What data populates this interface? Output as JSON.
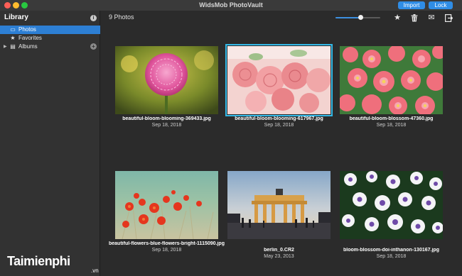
{
  "app": {
    "title": "WidsMob PhotoVault"
  },
  "titlebar": {
    "import_label": "Import",
    "lock_label": "Lock"
  },
  "sidebar": {
    "header": "Library",
    "info_glyph": "i",
    "items": [
      {
        "label": "Photos",
        "icon": "photos-icon",
        "glyph": "▭",
        "active": true
      },
      {
        "label": "Favorites",
        "icon": "star-icon",
        "glyph": "★",
        "active": false
      },
      {
        "label": "Albums",
        "icon": "albums-icon",
        "glyph": "▤",
        "active": false,
        "arrow": "▶",
        "add": "+"
      }
    ]
  },
  "toolbar": {
    "count_label": "9 Photos",
    "zoom_level": 0.55,
    "tools": [
      {
        "name": "favorite-star-icon",
        "glyph": "★"
      },
      {
        "name": "trash-icon",
        "glyph": "🗑"
      },
      {
        "name": "mail-icon",
        "glyph": "✉"
      },
      {
        "name": "export-icon",
        "glyph": "⇥"
      }
    ]
  },
  "photos": [
    {
      "name": "beautiful-bloom-blooming-369433.jpg",
      "date": "Sep 18, 2018",
      "selected": false
    },
    {
      "name": "beautiful-bloom-blooming-617967.jpg",
      "date": "Sep 18, 2018",
      "selected": true
    },
    {
      "name": "beautiful-bloom-blossom-47360.jpg",
      "date": "Sep 18, 2018",
      "selected": false
    },
    {
      "name": "beautiful-flowers-blue-flowers-bright-1115090.jpg",
      "date": "Sep 18, 2018",
      "selected": false
    },
    {
      "name": "berlin_0.CR2",
      "date": "May 23, 2013",
      "selected": false
    },
    {
      "name": "bloom-blossom-doi-inthanon-130167.jpg",
      "date": "Sep 18, 2018",
      "selected": false
    }
  ],
  "watermark": {
    "brand": "Taimienphi",
    "suffix": ".vn"
  },
  "colors": {
    "accent": "#2d7fd4",
    "selection": "#33b8e6",
    "button": "#2f8de6"
  }
}
